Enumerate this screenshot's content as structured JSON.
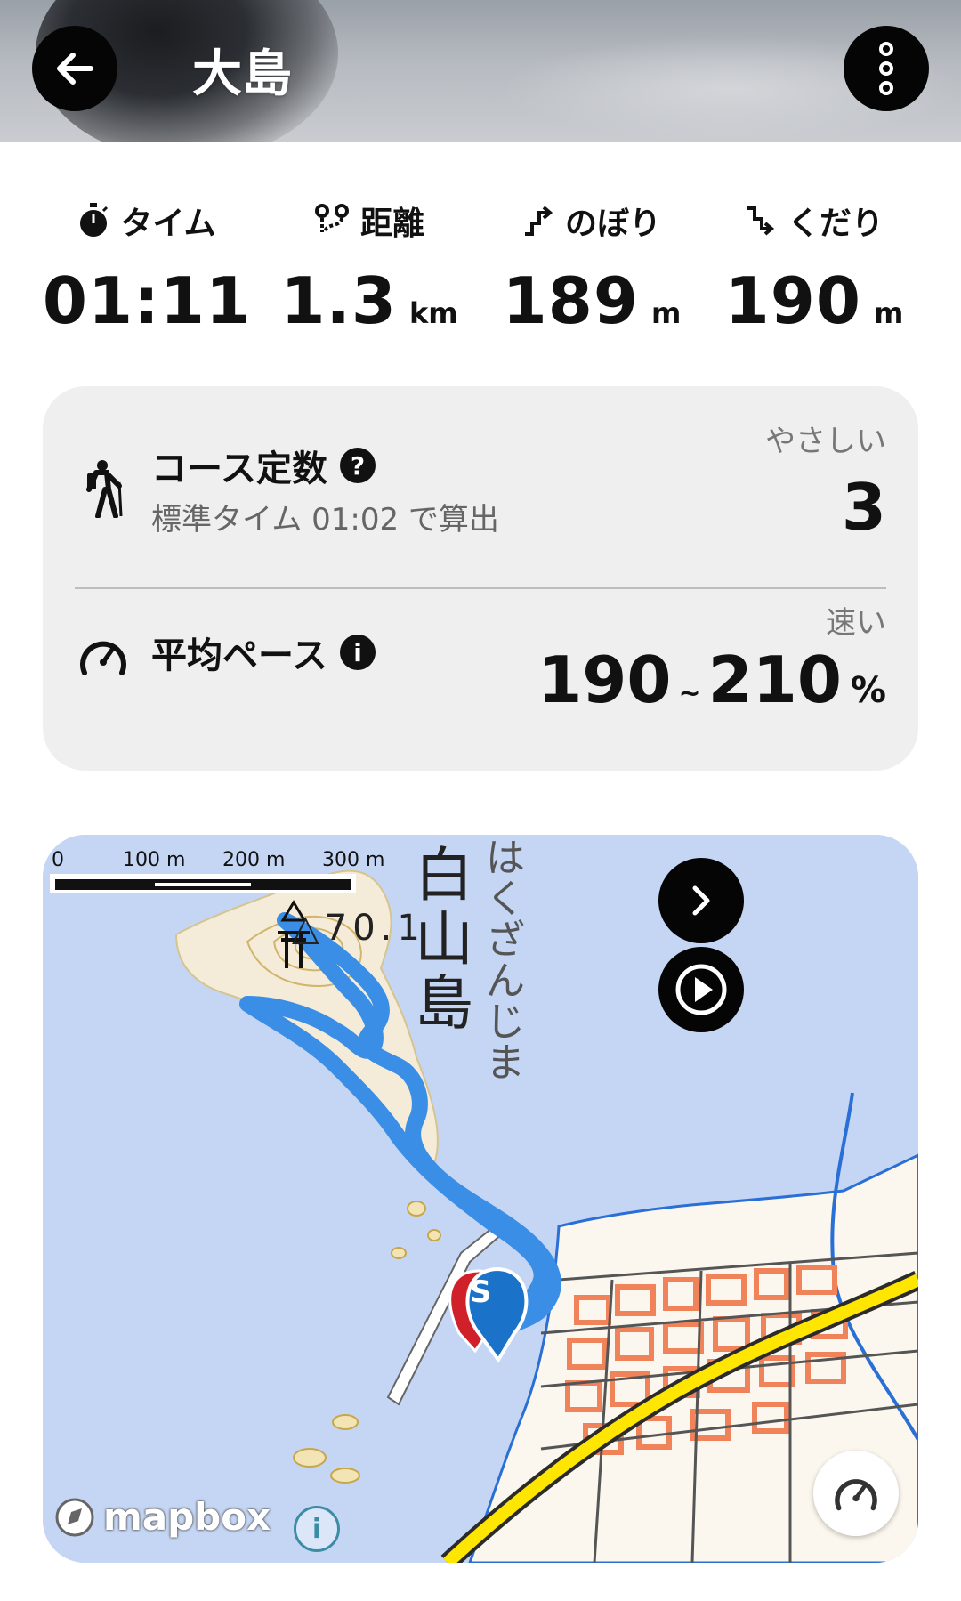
{
  "header": {
    "title": "大島",
    "back_icon": "arrow-left-icon",
    "menu_icon": "more-vertical-icon"
  },
  "stats": [
    {
      "label": "タイム",
      "icon": "stopwatch-icon",
      "value": "01:11",
      "unit": ""
    },
    {
      "label": "距離",
      "icon": "route-icon",
      "value": "1.3",
      "unit": "km"
    },
    {
      "label": "のぼり",
      "icon": "ascent-icon",
      "value": "189",
      "unit": "m"
    },
    {
      "label": "くだり",
      "icon": "descent-icon",
      "value": "190",
      "unit": "m"
    }
  ],
  "course": {
    "title": "コース定数",
    "help": "?",
    "subtitle": "標準タイム 01:02 で算出",
    "level": "やさしい",
    "value": "3"
  },
  "pace": {
    "title": "平均ペース",
    "info": "i",
    "level": "速い",
    "min": "190",
    "sep": "~",
    "max": "210",
    "unit": "%"
  },
  "map": {
    "scale": [
      "0",
      "100 m",
      "200 m",
      "300 m"
    ],
    "attribution": "mapbox",
    "info": "i",
    "island_name": "白山島",
    "island_reading": "はくざんじま",
    "summit_label": "△70.1",
    "start_marker": "S",
    "colors": {
      "water": "#c4d6f4",
      "track": "#3a8ee6",
      "road": "#ffe600",
      "building": "#f0835a"
    }
  }
}
